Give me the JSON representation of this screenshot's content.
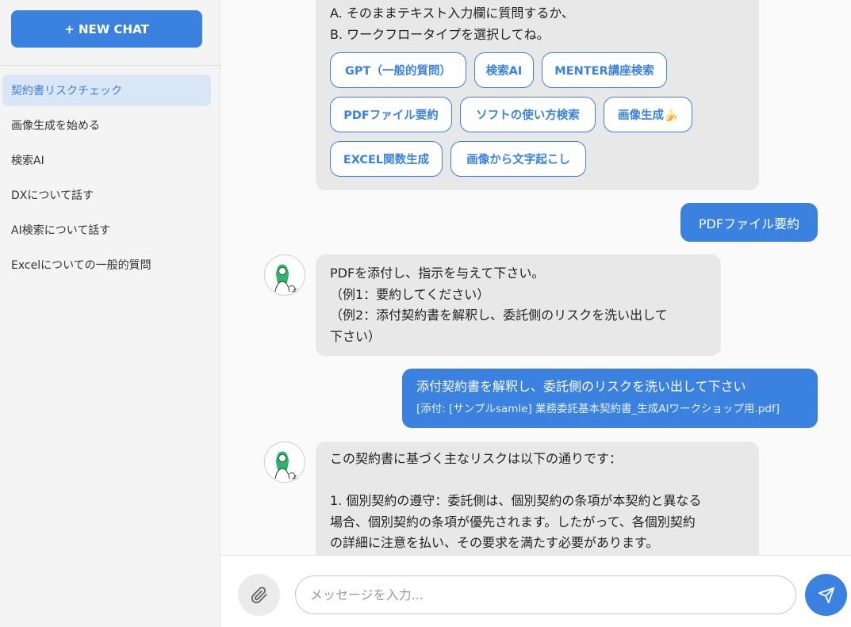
{
  "sidebar": {
    "new_chat_label": "+ NEW CHAT",
    "items": [
      {
        "label": "契約書リスクチェック",
        "active": true
      },
      {
        "label": "画像生成を始める"
      },
      {
        "label": "検索AI"
      },
      {
        "label": "DXについて話す"
      },
      {
        "label": "AI検索について話す"
      },
      {
        "label": "Excelについての一般的質問"
      }
    ]
  },
  "messages": {
    "m1": {
      "line_a": "A. そのままテキスト入力欄に質問するか、",
      "line_b": "B. ワークフロータイプを選択してね。",
      "chips": [
        "GPT（一般的質問）",
        "検索AI",
        "MENTER講座検索",
        "PDFファイル要約",
        "ソフトの使い方検索",
        "画像生成🍌",
        "EXCEL関数生成",
        "画像から文字起こし"
      ]
    },
    "m2": {
      "text": "PDFファイル要約"
    },
    "m3": {
      "lines": [
        "PDFを添付し、指示を与えて下さい。",
        "（例1：要約してください）",
        "（例2：添付契約書を解釈し、委託側のリスクを洗い出して",
        "下さい）"
      ]
    },
    "m4": {
      "text": "添付契約書を解釈し、委託側のリスクを洗い出して下さい",
      "attachment": "[添付: [サンプルsamle] 業務委託基本契約書_生成AIワークショップ用.pdf]"
    },
    "m5": {
      "lines": [
        "この契約書に基づく主なリスクは以下の通りです：",
        "",
        "1. 個別契約の遵守：委託側は、個別契約の条項が本契約と異なる",
        "場合、個別契約の条項が優先されます。したがって、各個別契約",
        "の詳細に注意を払い、その要求を満たす必要があります。"
      ]
    }
  },
  "composer": {
    "placeholder": "メッセージを入力...",
    "attach_icon": "paperclip-icon",
    "send_icon": "send-icon"
  },
  "colors": {
    "accent": "#3b82e0",
    "active_bg": "#d9e6f5",
    "bot_bubble": "#e8e8e8"
  }
}
